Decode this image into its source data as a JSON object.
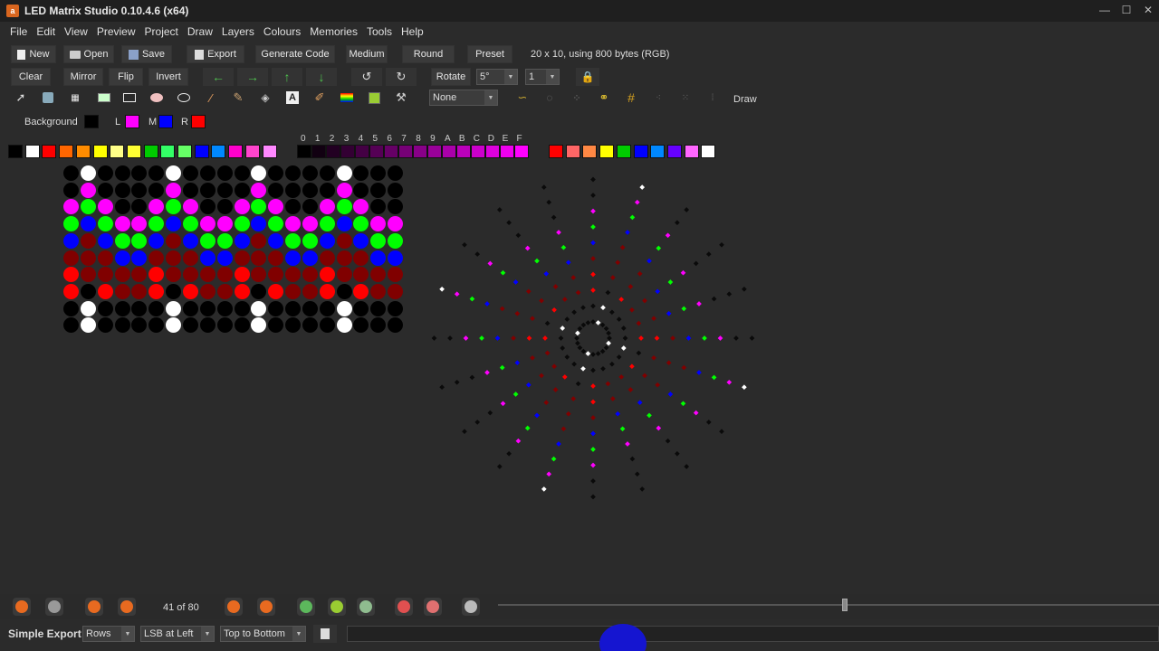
{
  "window": {
    "title": "LED Matrix Studio 0.10.4.6 (x64)",
    "icon_letter": "a"
  },
  "menu": [
    "File",
    "Edit",
    "View",
    "Preview",
    "Project",
    "Draw",
    "Layers",
    "Colours",
    "Memories",
    "Tools",
    "Help"
  ],
  "toolbar1": {
    "new": "New",
    "open": "Open",
    "save": "Save",
    "export": "Export",
    "generate": "Generate Code",
    "medium": "Medium",
    "round": "Round",
    "preset": "Preset",
    "info": "20 x 10, using 800 bytes (RGB)"
  },
  "toolbar2": {
    "clear": "Clear",
    "mirror": "Mirror",
    "flip": "Flip",
    "invert": "Invert",
    "rotate": "Rotate",
    "rotate_angle": "5°",
    "rotate_count": "1"
  },
  "toolbar3": {
    "gradient_option": "None",
    "mode": "Draw"
  },
  "colours": {
    "background_label": "Background",
    "l_label": "L",
    "m_label": "M",
    "r_label": "R",
    "background": "#000000",
    "left": "#ff00ff",
    "middle": "#0000ff",
    "right": "#ff0000"
  },
  "palette_left": [
    "#000000",
    "#ffffff",
    "#ff0000",
    "#ff6600",
    "#ff8c00",
    "#ffff00",
    "#ffff88",
    "#ffff33",
    "#00cc00",
    "#33ff66",
    "#66ff66",
    "#0000ff",
    "#0088ff",
    "#ff00cc",
    "#ff44cc",
    "#ff88ff"
  ],
  "palette_hex_labels": [
    "0",
    "1",
    "2",
    "3",
    "4",
    "5",
    "6",
    "7",
    "8",
    "9",
    "A",
    "B",
    "C",
    "D",
    "E",
    "F"
  ],
  "palette_shades": [
    "#000000",
    "#110011",
    "#220022",
    "#330033",
    "#440044",
    "#550055",
    "#660066",
    "#770077",
    "#880088",
    "#990099",
    "#aa00aa",
    "#bb00bb",
    "#cc00cc",
    "#dd00dd",
    "#ee00ee",
    "#ff00ff"
  ],
  "palette_right": [
    "#ff0000",
    "#ff6666",
    "#ff8844",
    "#ffff00",
    "#00cc00",
    "#0000ff",
    "#0088ff",
    "#6600ff",
    "#ff66ff",
    "#ffffff"
  ],
  "matrix": {
    "key": {
      "K": "#000000",
      "W": "#ffffff",
      "M": "#ff00ff",
      "G": "#00ff00",
      "B": "#0000ff",
      "D": "#800000",
      "R": "#ff0000"
    },
    "rows": [
      "KWKKKKWKKKKWKKKKWKKK",
      "KMKKKKMKKKKMKKKKMKKK",
      "MGMKKMGMKKMGMKKMGMKK",
      "GBGMMGBGMMGBGMMGBGMM",
      "BDBGGBDBGGBDBGGBDBGG",
      "DDDBBDDDBBDDDBBDDDBB",
      "RDDDDRDDDDRDDDDRDDDD",
      "RKRDDRKRDDRKRDDRKRDD",
      "KWKKKKWKKKKWKKKKWKKK",
      "KWKKKKWKKKKWKKKKWKKK"
    ]
  },
  "animation": {
    "frame": "41 of 80"
  },
  "export": {
    "label": "Simple Export",
    "direction": "Rows",
    "bit_order": "LSB at Left",
    "scan": "Top to Bottom"
  }
}
